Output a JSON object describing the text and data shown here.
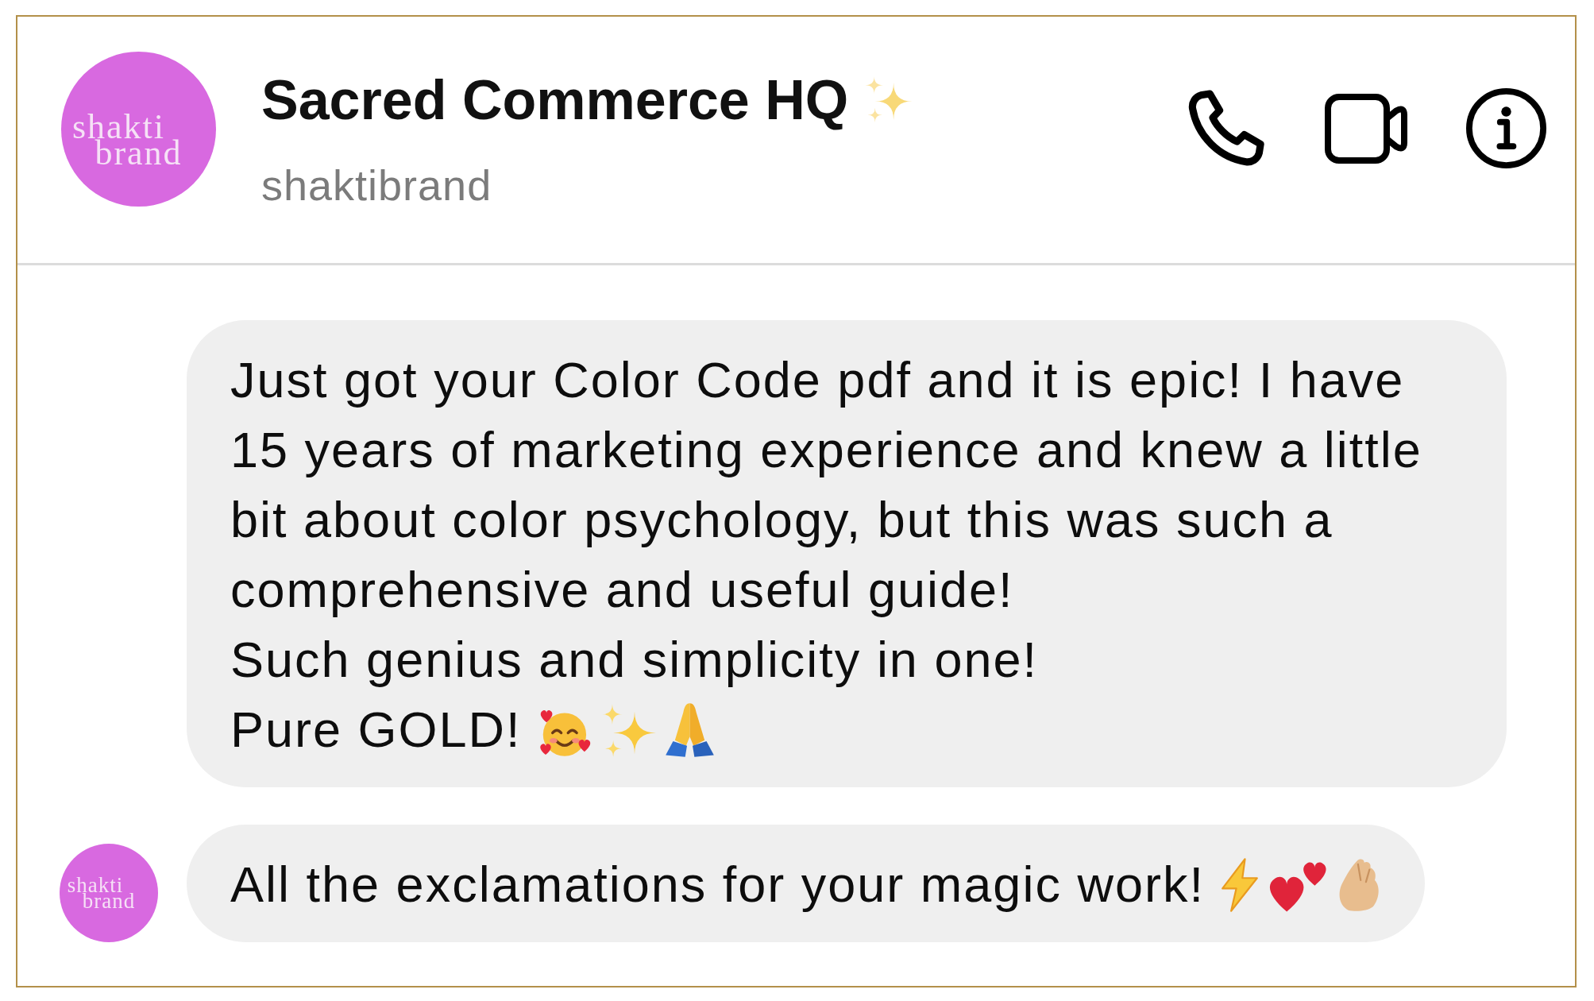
{
  "header": {
    "avatar": {
      "logo_text": [
        "shakti",
        "brand"
      ]
    },
    "title": "Sacred Commerce HQ",
    "subtitle": "shaktibrand"
  },
  "messages": [
    {
      "paragraphs": [
        "Just got your Color Code pdf and it is epic! I have 15 years of marketing experience and knew a little bit about color psychology, but this was such a comprehensive and useful guide!",
        "Such genius and simplicity in one!",
        "Pure GOLD!"
      ]
    },
    {
      "avatar": {
        "logo_text": [
          "shakti",
          "brand"
        ]
      },
      "paragraphs": [
        "All the exclamations for your magic work!"
      ]
    }
  ]
}
